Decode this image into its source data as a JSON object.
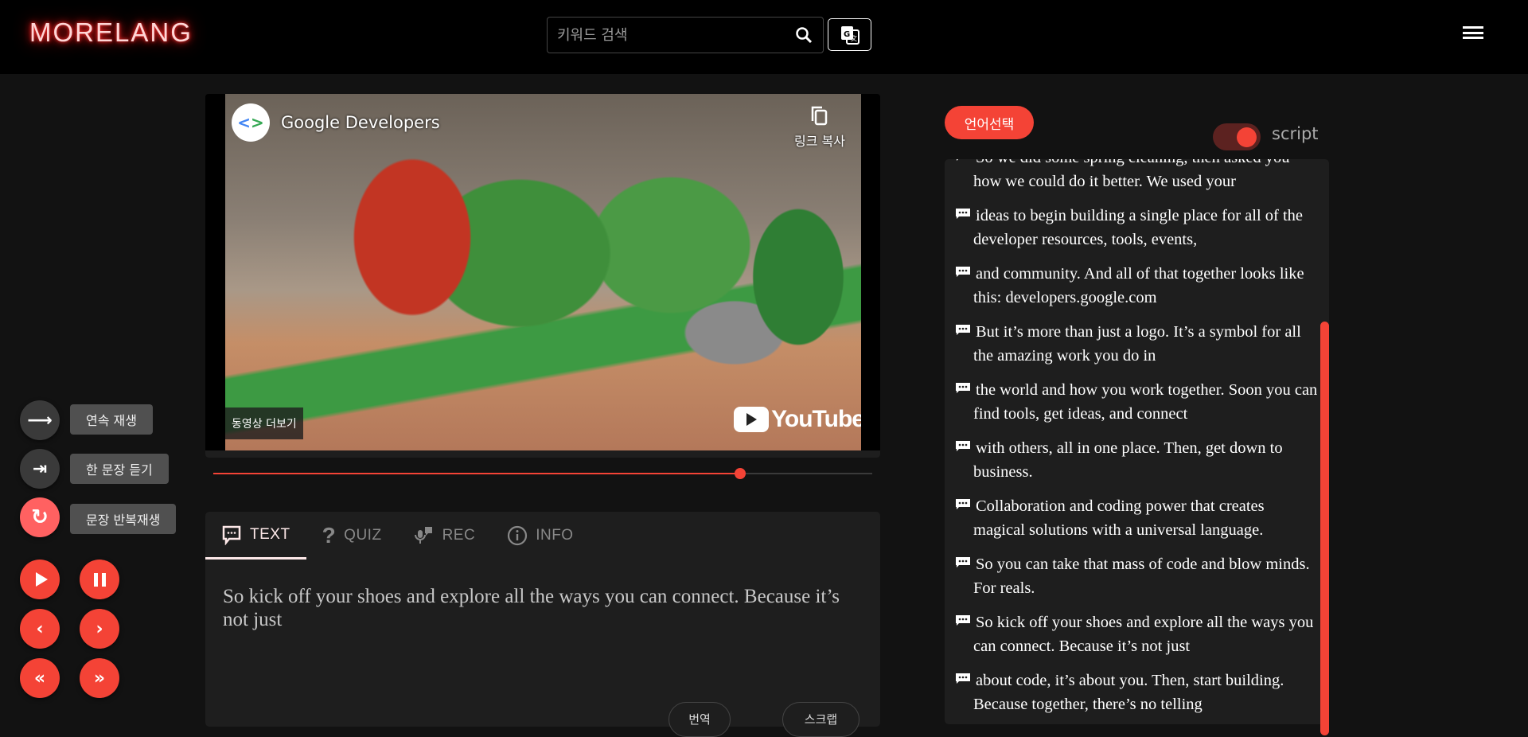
{
  "header": {
    "logo": "MORELANG",
    "search_placeholder": "키워드 검색",
    "search_icon": "search-icon",
    "translate_icon": "google-translate-icon",
    "menu_icon": "hamburger-menu-icon"
  },
  "video": {
    "channel_name": "Google Developers",
    "copy_link": "링크 복사",
    "more_videos": "동영상 더보기",
    "youtube_logo": "YouTube",
    "progress": 0.8
  },
  "controls": {
    "modes": [
      {
        "label": "연속 재생",
        "icon": "arrow-right-icon",
        "active": false
      },
      {
        "label": "한 문장 듣기",
        "icon": "arrow-right-to-bar-icon",
        "active": false
      },
      {
        "label": "문장 반복재생",
        "icon": "repeat-icon",
        "active": true
      }
    ],
    "buttons": [
      "play",
      "pause",
      "previous",
      "next",
      "rewind",
      "fast-forward"
    ]
  },
  "tabs": [
    {
      "label": "TEXT",
      "active": true
    },
    {
      "label": "QUIZ",
      "active": false
    },
    {
      "label": "REC",
      "active": false
    },
    {
      "label": "INFO",
      "active": false
    }
  ],
  "current_sentence": "So kick off your shoes and explore all the ways you can connect. Because it’s not just",
  "actions": {
    "translate": "번역",
    "scrap": "스크랩"
  },
  "script_panel": {
    "language_button": "언어선택",
    "toggle_label": "script",
    "toggle_on": true,
    "items": [
      "So we did some spring cleaning, then asked you how we could do it better. We used your",
      "ideas to begin building a single place for all of the developer resources, tools, events,",
      "and community. And all of that together looks like this: developers.google.com",
      "But it’s more than just a logo. It’s a symbol for all the amazing work you do in",
      "the world and how you work together. Soon you can find tools, get ideas, and connect",
      "with others, all in one place. Then, get down to business.",
      "Collaboration and coding power that creates magical solutions with a universal language.",
      "So you can take that mass of code and blow minds. For reals.",
      "So kick off your shoes and explore all the ways you can connect. Because it’s not just",
      "about code, it’s about you. Then, start building. Because together, there’s no telling"
    ]
  },
  "colors": {
    "accent": "#f44336",
    "background": "#121212",
    "panel": "#1e1e1e",
    "header": "#000000"
  }
}
